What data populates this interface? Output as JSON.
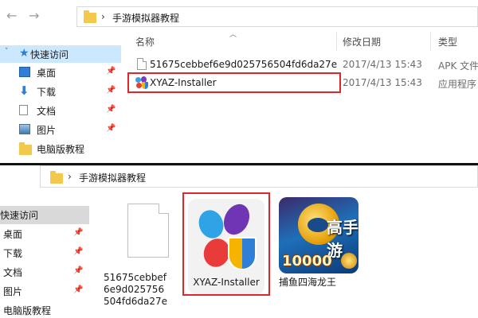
{
  "top_window": {
    "breadcrumb": [
      "手游模拟器教程"
    ],
    "columns": {
      "name": "名称",
      "date": "修改日期",
      "type": "类型"
    },
    "sidebar": [
      {
        "label": "快速访问",
        "icon": "star-icon",
        "selected": true
      },
      {
        "label": "桌面",
        "icon": "desktop-icon",
        "pinned": true
      },
      {
        "label": "下载",
        "icon": "download-arrow-icon",
        "pinned": true
      },
      {
        "label": "文档",
        "icon": "document-icon",
        "pinned": true
      },
      {
        "label": "图片",
        "icon": "pictures-icon",
        "pinned": true
      },
      {
        "label": "电脑版教程",
        "icon": "folder-icon"
      }
    ],
    "files": [
      {
        "name": "51675cebbef6e9d025756504fd6da27e",
        "date": "2017/4/13 15:43",
        "type": "APK 文件",
        "icon": "generic-file-icon"
      },
      {
        "name": "XYAZ-Installer",
        "date": "2017/4/13 15:43",
        "type": "应用程序",
        "icon": "xyaz-app-icon",
        "highlighted": true
      }
    ]
  },
  "bottom_window": {
    "breadcrumb": [
      "手游模拟器教程"
    ],
    "sidebar": [
      {
        "label": "快速访问",
        "selected": true
      },
      {
        "label": "桌面",
        "pinned": true
      },
      {
        "label": "下载",
        "pinned": true
      },
      {
        "label": "文档",
        "pinned": true
      },
      {
        "label": "图片",
        "pinned": true
      },
      {
        "label": "电脑版教程"
      }
    ],
    "tiles": [
      {
        "label": "51675cebbef6e9d025756504fd6da27e",
        "icon": "generic-file-icon"
      },
      {
        "label": "XYAZ-Installer",
        "icon": "xyaz-installer-icon",
        "highlighted": true
      },
      {
        "label": "捕鱼四海龙王",
        "icon": "fishing-game-icon",
        "badge": "10000",
        "watermark": "高手游"
      }
    ]
  },
  "colors": {
    "highlight_box": "#e0262a",
    "selection": "#cce8ff",
    "folder": "#f2c94c",
    "shield_blue": "#2f7fd6",
    "shield_yellow": "#f6b400"
  }
}
